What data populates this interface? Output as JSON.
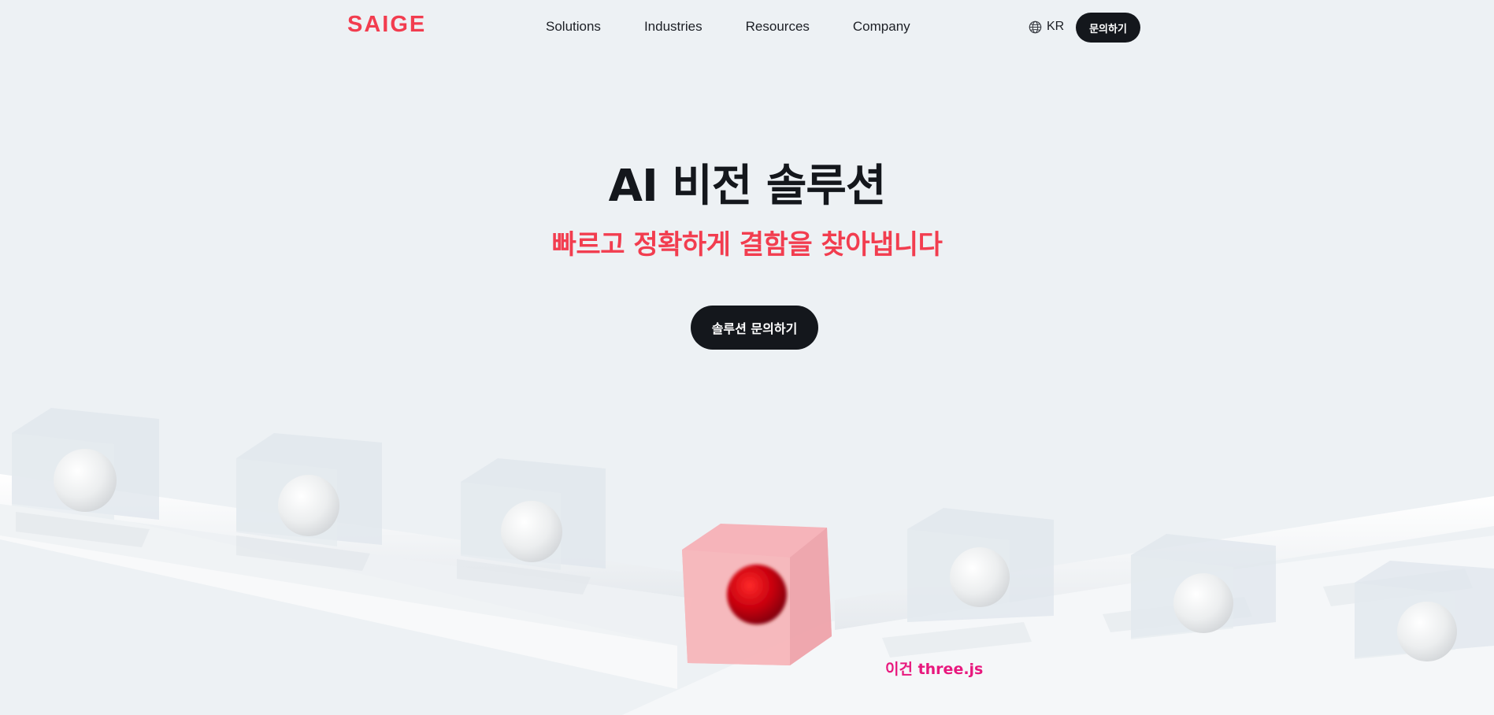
{
  "header": {
    "logo_text": "SAIGE",
    "nav": [
      {
        "label": "Solutions"
      },
      {
        "label": "Industries"
      },
      {
        "label": "Resources"
      },
      {
        "label": "Company"
      }
    ],
    "language": {
      "label": "KR",
      "icon": "globe-icon"
    },
    "contact_button": "문의하기"
  },
  "hero": {
    "title": "AI 비전 솔루션",
    "subtitle": "빠르고 정확하게 결함을 찾아냅니다",
    "cta_button": "솔루션 문의하기"
  },
  "scene": {
    "caption": "이건 three.js"
  },
  "colors": {
    "brand_red": "#f23d4f",
    "dark": "#14171c",
    "background": "#edf1f4",
    "caption_pink": "#e8197e",
    "defect_cube": "#f7b0b6",
    "defect_sphere": "#c8000e"
  }
}
